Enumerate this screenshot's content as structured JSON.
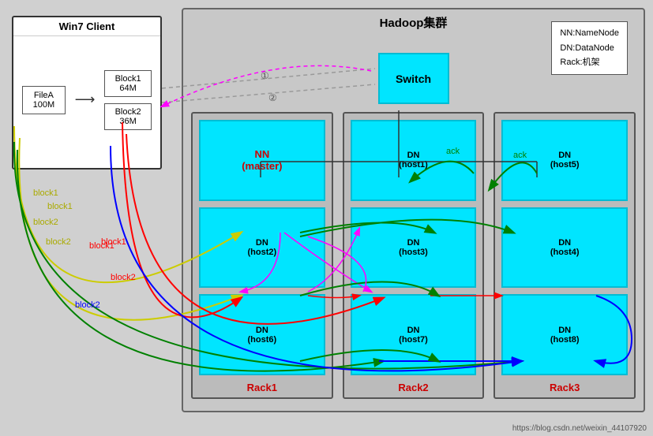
{
  "win7": {
    "title": "Win7 Client",
    "file": {
      "name": "FileA",
      "size": "100M"
    },
    "block1": {
      "name": "Block1",
      "size": "64M"
    },
    "block2": {
      "name": "Block2",
      "size": "36M"
    }
  },
  "hadoop": {
    "title": "Hadoop集群",
    "switch_label": "Switch"
  },
  "legend": {
    "nn": "NN:NameNode",
    "dn": "DN:DataNode",
    "rack": "Rack:机架"
  },
  "racks": [
    {
      "label": "Rack1",
      "nodes": [
        {
          "id": "nn-master",
          "name": "NN\n(master)",
          "is_master": true
        },
        {
          "id": "dn-host2",
          "name": "DN\n(host2)",
          "is_master": false
        },
        {
          "id": "dn-host6",
          "name": "DN\n(host6)",
          "is_master": false
        }
      ]
    },
    {
      "label": "Rack2",
      "nodes": [
        {
          "id": "dn-host1",
          "name": "DN\n(host1)",
          "is_master": false
        },
        {
          "id": "dn-host3",
          "name": "DN\n(host3)",
          "is_master": false
        },
        {
          "id": "dn-host7",
          "name": "DN\n(host7)",
          "is_master": false
        }
      ]
    },
    {
      "label": "Rack3",
      "nodes": [
        {
          "id": "dn-host5",
          "name": "DN\n(host5)",
          "is_master": false
        },
        {
          "id": "dn-host4",
          "name": "DN\n(host4)",
          "is_master": false
        },
        {
          "id": "dn-host8",
          "name": "DN\n(host8)",
          "is_master": false
        }
      ]
    }
  ],
  "labels": {
    "block1": "block1",
    "block2": "block2",
    "ack": "ack",
    "num1": "①",
    "num2": "②"
  },
  "watermark": "https://blog.csdn.net/weixin_44107920"
}
